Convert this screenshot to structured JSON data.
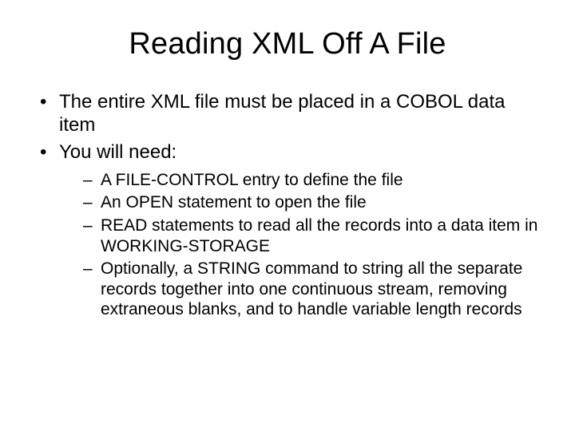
{
  "slide": {
    "title": "Reading XML Off A File",
    "bullets": [
      {
        "text": "The entire XML file must be placed in a COBOL data item"
      },
      {
        "text": "You will need:"
      }
    ],
    "subbullets": [
      {
        "text": "A FILE-CONTROL entry to define the file"
      },
      {
        "text": "An OPEN statement to open the file"
      },
      {
        "text": "READ statements to read all the records into a data item in WORKING-STORAGE"
      },
      {
        "text": "Optionally, a STRING command to string all the separate records together into one continuous stream, removing extraneous blanks, and to handle variable length records"
      }
    ]
  }
}
